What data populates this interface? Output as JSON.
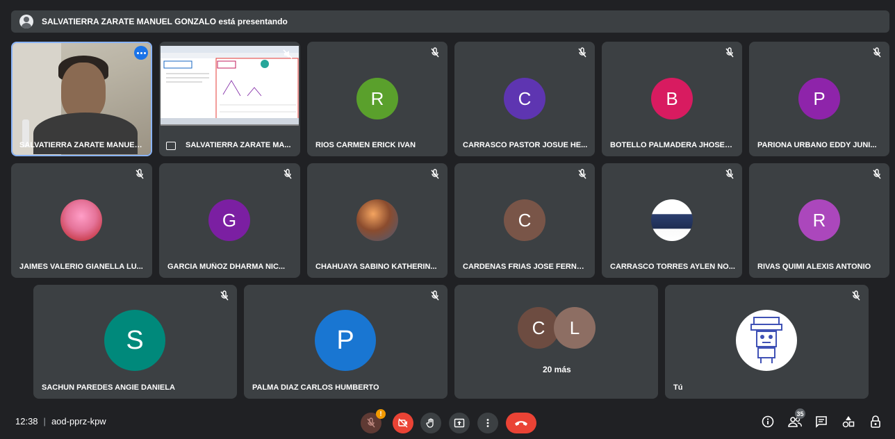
{
  "banner": {
    "text": "SALVATIERRA ZARATE MANUEL GONZALO está presentando"
  },
  "tiles": [
    {
      "name": "SALVATIERRA ZARATE MANUEL..."
    },
    {
      "name": "SALVATIERRA ZARATE MA..."
    },
    {
      "name": "RIOS CARMEN ERICK IVAN",
      "initial": "R",
      "color": "#5aa02c"
    },
    {
      "name": "CARRASCO PASTOR JOSUE HE...",
      "initial": "C",
      "color": "#5e35b1"
    },
    {
      "name": "BOTELLO PALMADERA JHOSEL...",
      "initial": "B",
      "color": "#d81b60"
    },
    {
      "name": "PARIONA URBANO EDDY JUNI...",
      "initial": "P",
      "color": "#8e24aa"
    },
    {
      "name": "JAIMES VALERIO GIANELLA LU..."
    },
    {
      "name": "GARCIA MUÑOZ DHARMA NIC...",
      "initial": "G",
      "color": "#7b1fa2"
    },
    {
      "name": "CHAHUAYA SABINO KATHERIN..."
    },
    {
      "name": "CARDENAS FRIAS JOSE FERNA...",
      "initial": "C",
      "color": "#795548"
    },
    {
      "name": "CARRASCO TORRES AYLEN NO..."
    },
    {
      "name": "RIVAS QUIMI ALEXIS ANTONIO",
      "initial": "R",
      "color": "#ab47bc"
    },
    {
      "name": "SACHUN PAREDES ANGIE DANIELA",
      "initial": "S",
      "color": "#00897b"
    },
    {
      "name": "PALMA DIAZ CARLOS HUMBERTO",
      "initial": "P",
      "color": "#1976d2"
    },
    {
      "more_label": "20 más",
      "initials": [
        "C",
        "L"
      ],
      "colors": [
        "#6d4c41",
        "#8d6e63"
      ]
    },
    {
      "name": "Tú"
    }
  ],
  "meeting": {
    "time": "12:38",
    "separator": "|",
    "code": "aod-pprz-kpw"
  },
  "controls": {
    "mic_badge": "!",
    "people_count": "35"
  },
  "colors": {
    "background": "#202124",
    "tile": "#3c4043",
    "end_call": "#ea4335",
    "active_border": "#8ab4f8"
  },
  "icons": [
    "mic-off-icon",
    "camera-off-icon",
    "hand-raise-icon",
    "present-icon",
    "more-vert-icon",
    "end-call-icon",
    "info-icon",
    "people-icon",
    "chat-icon",
    "activities-icon",
    "host-controls-icon"
  ]
}
